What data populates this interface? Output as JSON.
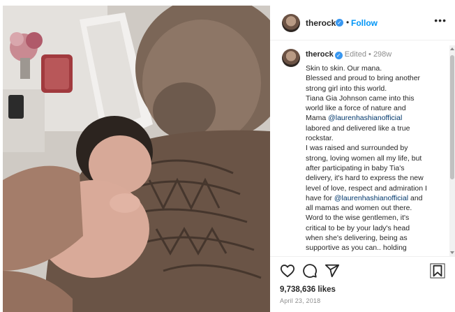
{
  "post": {
    "username": "therock",
    "follow_label": "Follow",
    "more_label": "•••",
    "separator": "•",
    "verified_glyph": "✓"
  },
  "caption": {
    "username": "therock",
    "edited_label": "Edited",
    "time_ago": "298w",
    "lines": [
      "Skin to skin. Our mana.",
      "Blessed and proud to bring another",
      "strong girl into this world.",
      "Tiana Gia Johnson came into this",
      "world like a force of nature and",
      "Mama @laurenhashianofficial",
      "labored and delivered like a true",
      "rockstar.",
      "I was raised and surrounded by",
      "strong, loving women all my life, but",
      "after participating in baby Tia's",
      "delivery, it's hard to express the new",
      "level of love, respect and admiration I",
      "have for @laurenhashianofficial and",
      "all mamas and women out there.",
      "Word to the wise gentlemen, it's",
      "critical to be by your lady's head",
      "when she's delivering, being as",
      "supportive as you can.. holding"
    ]
  },
  "actions": {
    "icons": [
      "heart-icon",
      "comment-icon",
      "share-icon",
      "bookmark-icon"
    ]
  },
  "stats": {
    "likes": "9,738,636 likes",
    "date": "April 23, 2018"
  },
  "colors": {
    "link_blue": "#0095f6",
    "mention": "#00376b",
    "verified": "#3897f0",
    "muted": "#8e8e8e"
  }
}
